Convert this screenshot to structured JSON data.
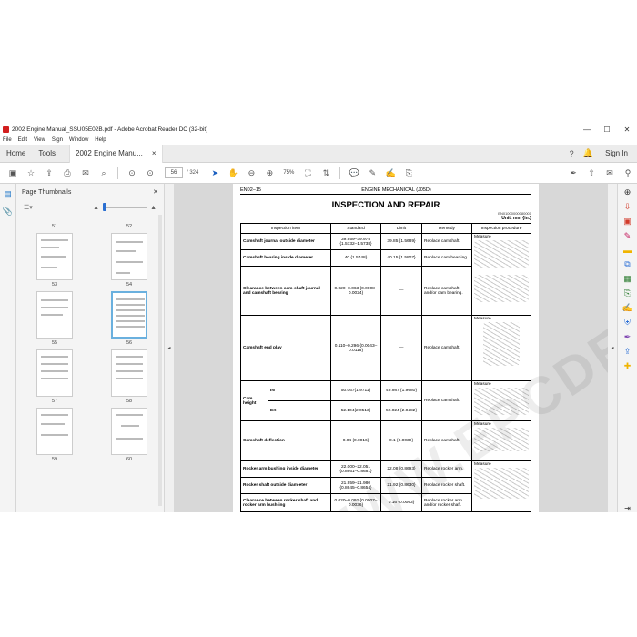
{
  "window": {
    "title": "2002 Engine Manual_SSU05E02B.pdf - Adobe Acrobat Reader DC (32-bit)",
    "minimize": "—",
    "maximize": "☐",
    "close": "✕"
  },
  "menu": [
    "File",
    "Edit",
    "View",
    "Sign",
    "Window",
    "Help"
  ],
  "tabs": {
    "home": "Home",
    "tools": "Tools",
    "doc": "2002 Engine Manu...",
    "doc_close": "×",
    "signin": "Sign In"
  },
  "toolbar": {
    "page_current": "56",
    "page_total": "/ 324",
    "zoom": "75%"
  },
  "thumbnails": {
    "title": "Page Thumbnails",
    "rows": [
      {
        "left": "51",
        "right": "52"
      },
      {
        "left": "53",
        "right": "54"
      },
      {
        "left": "55",
        "right": "56"
      },
      {
        "left": "57",
        "right": "58"
      },
      {
        "left": "59",
        "right": "60"
      }
    ]
  },
  "doc": {
    "header_left": "EN02–15",
    "header_center": "ENGINE MECHANICAL (J05D)",
    "title": "INSPECTION AND REPAIR",
    "ref": "EN01000000080001",
    "unit": "Unit: mm {in.}",
    "columns": [
      "Inspection item",
      "Standard",
      "Limit",
      "Remedy",
      "Inspection procedure"
    ],
    "rows": [
      {
        "item": "Camshaft journal outside diameter",
        "standard": "39.959–39.975 {1.5732–1.5738}",
        "limit": "39.85 {1.5689}",
        "remedy": "Replace camshaft.",
        "proc": "Measure"
      },
      {
        "item": "Camshaft bearing inside diameter",
        "standard": "40 {1.5748}",
        "limit": "40.15 {1.5807}",
        "remedy": "Replace cam bear-ing.",
        "proc": ""
      },
      {
        "item": "Clearance between cam-shaft journal and camshaft bearing",
        "standard": "0.020–0.063 {0.0008–0.0024}",
        "limit": "—",
        "remedy": "Replace camshaft and/or cam bearing.",
        "proc": ""
      },
      {
        "item": "Camshaft end play",
        "standard": "0.110–0.296 {0.0043–0.0116}",
        "limit": "—",
        "remedy": "Replace camshaft.",
        "proc": "Measure"
      },
      {
        "item": "Cam height",
        "sub1": "IN",
        "standard": "50.067{1.9711}",
        "limit": "49.987 {1.9680}",
        "sub2": "EX",
        "standard2": "52.104{2.0513}",
        "limit2": "52.024 {2.0482}",
        "remedy": "Replace camshaft.",
        "proc": "Measure"
      },
      {
        "item": "Camshaft deflection",
        "standard": "0.04 {0.0016}",
        "limit": "0.1 {0.0039}",
        "remedy": "Replace camshaft.",
        "proc": "Measure"
      },
      {
        "item": "Rocker arm bushing inside diameter",
        "standard": "22.000–22.051 {0.8661–0.8681}",
        "limit": "22.08 {0.8693}",
        "remedy": "Replace rocker arm.",
        "proc": "Measure"
      },
      {
        "item": "Rocker shaft outside diam-eter",
        "standard": "21.959–21.980 {0.8645–0.8654}",
        "limit": "21.92 {0.8630}",
        "remedy": "Replace rocker shaft.",
        "proc": ""
      },
      {
        "item": "Clearance between rocker shaft and rocker arm bush-ing",
        "standard": "0.020–0.092 {0.0007–0.0036}",
        "limit": "0.16 {0.0063}",
        "remedy": "Replace rocker arm and/or rocker shaft.",
        "proc": ""
      }
    ],
    "watermark": "WWW.EPCDEPOT.COM"
  }
}
